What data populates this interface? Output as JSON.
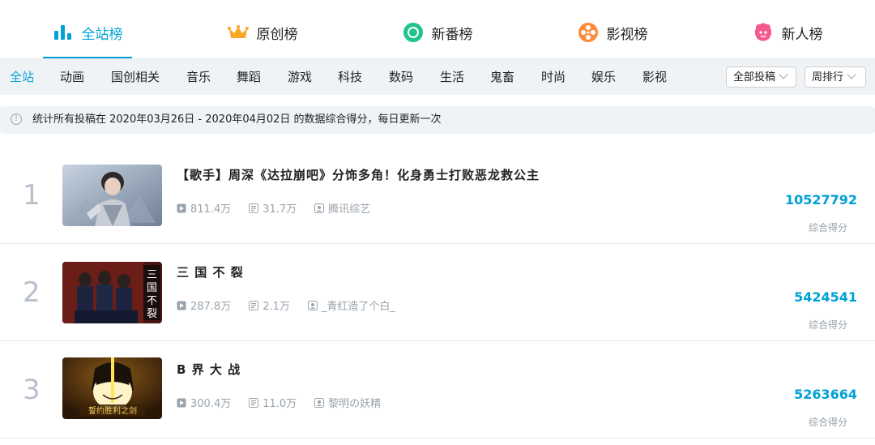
{
  "tabs": [
    {
      "label": "全站榜",
      "icon": "bar-chart-icon",
      "active": true
    },
    {
      "label": "原创榜",
      "icon": "crown-icon",
      "active": false
    },
    {
      "label": "新番榜",
      "icon": "circle-icon",
      "active": false
    },
    {
      "label": "影视榜",
      "icon": "film-reel-icon",
      "active": false
    },
    {
      "label": "新人榜",
      "icon": "face-icon",
      "active": false
    }
  ],
  "categories": [
    "全站",
    "动画",
    "国创相关",
    "音乐",
    "舞蹈",
    "游戏",
    "科技",
    "数码",
    "生活",
    "鬼畜",
    "时尚",
    "娱乐",
    "影视"
  ],
  "active_category": "全站",
  "filters": {
    "type": "全部投稿",
    "period": "周排行"
  },
  "notice": "统计所有投稿在 2020年03月26日 - 2020年04月02日 的数据综合得分，每日更新一次",
  "colors": {
    "accent": "#00a1d6",
    "muted": "#99a2aa",
    "rank": "#b8c0cc"
  },
  "items": [
    {
      "rank": "1",
      "title": "【歌手】周深《达拉崩吧》分饰多角！化身勇士打败恶龙救公主",
      "plays": "811.4万",
      "danmaku": "31.7万",
      "author": "腾讯综艺",
      "score": "10527792",
      "score_label": "综合得分"
    },
    {
      "rank": "2",
      "title": "三 国 不 裂",
      "plays": "287.8万",
      "danmaku": "2.1万",
      "author": "_青红造了个白_",
      "score": "5424541",
      "score_label": "综合得分",
      "thumb_text": "三国不裂"
    },
    {
      "rank": "3",
      "title": "B 界 大 战",
      "plays": "300.4万",
      "danmaku": "11.0万",
      "author": "黎明の妖精",
      "score": "5263664",
      "score_label": "综合得分",
      "thumb_text": "誓约胜利之剑"
    }
  ]
}
